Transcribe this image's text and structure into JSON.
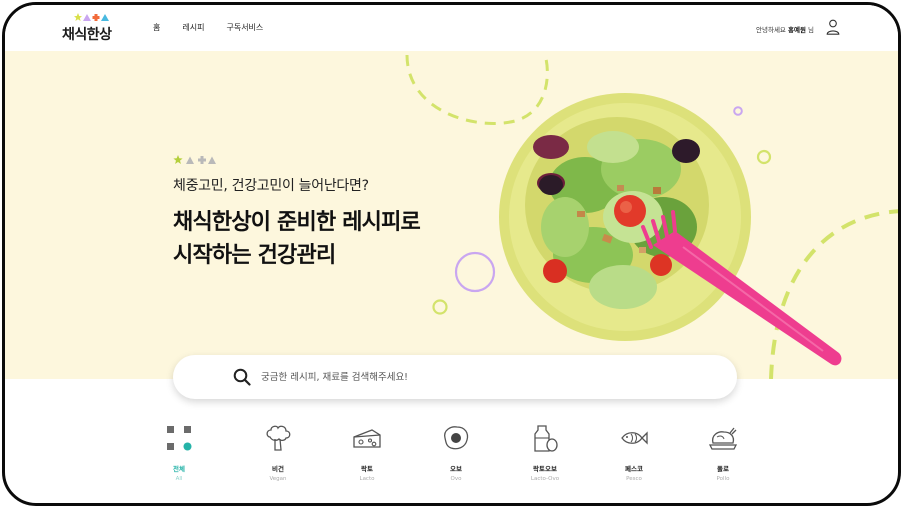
{
  "header": {
    "logo_text": "채식한상",
    "nav": [
      "홈",
      "레시피",
      "구독서비스"
    ],
    "greeting_prefix": "안녕하세요",
    "user_name": "홍예원",
    "greeting_suffix": "님"
  },
  "hero": {
    "subtitle": "체중고민, 건강고민이 늘어난다면?",
    "title_line1": "채식한상이 준비한 레시피로",
    "title_line2": "시작하는 건강관리"
  },
  "search": {
    "placeholder": "궁금한 레시피, 재료를 검색해주세요!"
  },
  "categories": [
    {
      "label": "전체",
      "sub": "All",
      "icon": "grid-icon",
      "active": true
    },
    {
      "label": "비건",
      "sub": "Vegan",
      "icon": "broccoli-icon",
      "active": false
    },
    {
      "label": "락토",
      "sub": "Lacto",
      "icon": "cheese-icon",
      "active": false
    },
    {
      "label": "오보",
      "sub": "Ovo",
      "icon": "egg-icon",
      "active": false
    },
    {
      "label": "락토오보",
      "sub": "Lacto-Ovo",
      "icon": "milk-egg-icon",
      "active": false
    },
    {
      "label": "페스코",
      "sub": "Pesco",
      "icon": "fish-icon",
      "active": false
    },
    {
      "label": "폴로",
      "sub": "Pollo",
      "icon": "chicken-icon",
      "active": false
    }
  ],
  "colors": {
    "accent": "#25b3a8",
    "hero_bg": "#fdf7dd",
    "lime": "#d3e36b",
    "lavender": "#c9a6f0",
    "fork": "#ee3d8f"
  }
}
